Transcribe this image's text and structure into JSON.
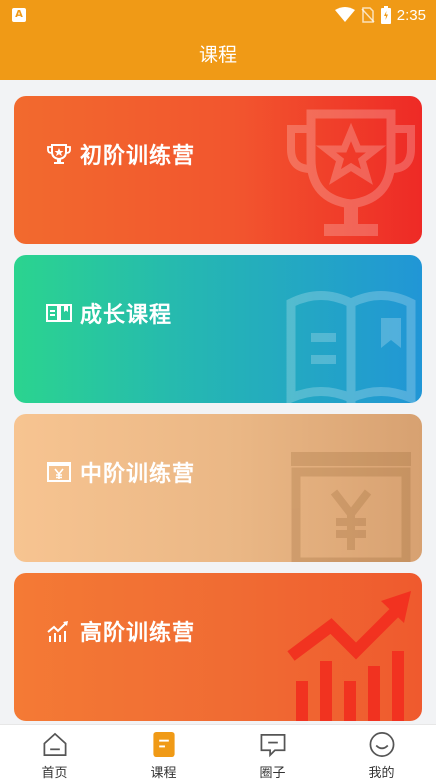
{
  "status": {
    "time": "2:35",
    "badge": "A"
  },
  "header": {
    "title": "课程"
  },
  "cards": [
    {
      "label": "初阶训练营",
      "icon": "trophy-icon"
    },
    {
      "label": "成长课程",
      "icon": "book-icon"
    },
    {
      "label": "中阶训练营",
      "icon": "yen-certificate-icon"
    },
    {
      "label": "高阶训练营",
      "icon": "growth-chart-icon"
    }
  ],
  "tabs": [
    {
      "label": "首页",
      "icon": "home-icon",
      "active": false
    },
    {
      "label": "课程",
      "icon": "course-icon",
      "active": true
    },
    {
      "label": "圈子",
      "icon": "chat-icon",
      "active": false
    },
    {
      "label": "我的",
      "icon": "smile-icon",
      "active": false
    }
  ],
  "colors": {
    "accent": "#f09a16",
    "active_tab": "#f09a16",
    "inactive_tab": "#555555"
  }
}
